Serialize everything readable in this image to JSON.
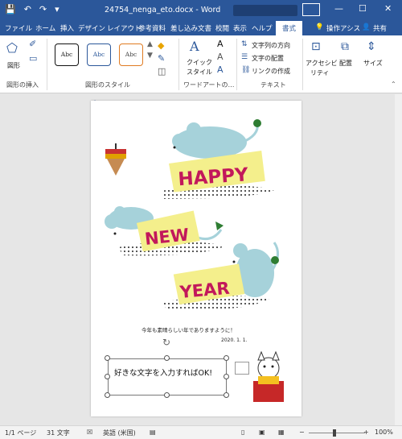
{
  "title_bar": {
    "doc_title": "24754_nenga_eto.docx  -  Word",
    "account_badge": "",
    "save_icon": "save-icon",
    "undo_icon": "undo-icon",
    "redo_icon": "redo-icon"
  },
  "tabs": {
    "file": "ファイル",
    "home": "ホーム",
    "insert": "挿入",
    "design": "デザイン",
    "layout": "レイアウト",
    "references": "参考資料",
    "mailings": "差し込み文書",
    "review": "校閲",
    "view": "表示",
    "help": "ヘルプ",
    "format": "書式",
    "tell_me": "操作アシス",
    "share": "共有"
  },
  "ribbon": {
    "shape": "図形",
    "insert_shapes_group": "図形の挿入",
    "style_samples": [
      "Abc",
      "Abc",
      "Abc"
    ],
    "shape_styles_group": "図形のスタイル",
    "quick_styles": "クイック",
    "quick_styles_2": "スタイル",
    "wordart_group": "ワードアートの…",
    "text_direction": "文字列の方向",
    "align_text": "文字の配置",
    "create_link": "リンクの作成",
    "text_group": "テキスト",
    "accessibility": "アクセシビ",
    "accessibility_2": "リティ",
    "arrange": "配置",
    "size": "サイズ"
  },
  "document": {
    "happy": "HAPPY",
    "new": "NEW",
    "year": "YEAR",
    "greeting": "今年も素晴らしい年でありますように！",
    "date": "2020. 1. 1.",
    "textbox_text": "好きな文字を入力すればOK!"
  },
  "status_bar": {
    "page": "1/1 ページ",
    "words": "31 文字",
    "language": "英語 (米国)",
    "zoom": "100%"
  },
  "colors": {
    "title_bar": "#2b579a",
    "letters": "#c2185b",
    "card_yellow": "#f4ef8c",
    "mouse_blue": "#a6d2da"
  }
}
